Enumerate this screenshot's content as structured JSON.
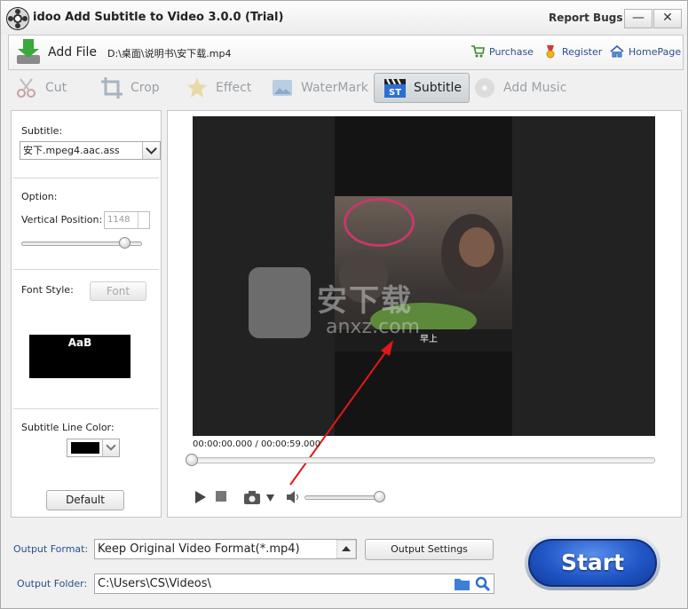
{
  "window": {
    "title": "idoo Add Subtitle to Video 3.0.0 (Trial)",
    "report_bugs": "Report Bugs",
    "minimize": "—",
    "close": "✕"
  },
  "top_bar": {
    "add_file": "Add File",
    "file_path": "D:\\桌面\\说明书\\安下载.mp4",
    "purchase": "Purchase",
    "register": "Register",
    "homepage": "HomePage"
  },
  "tools": {
    "cut": "Cut",
    "crop": "Crop",
    "effect": "Effect",
    "watermark": "WaterMark",
    "subtitle": "Subtitle",
    "add_music": "Add Music"
  },
  "left_panel": {
    "subtitle_label": "Subtitle:",
    "subtitle_value": "安下.mpeg4.aac.ass",
    "option_label": "Option:",
    "vertical_position_label": "Vertical Position:",
    "vertical_position_value": "1148",
    "vertical_position_slider_fraction": 0.85,
    "font_style_label": "Font Style:",
    "font_button": "Font",
    "font_preview": "AaB",
    "subtitle_line_color_label": "Subtitle Line Color:",
    "subtitle_line_color": "#000000",
    "default_button": "Default"
  },
  "player": {
    "current_time": "00:00:00.000",
    "separator": "/",
    "total_time": "00:00:59.000",
    "subtitle_text": "早上",
    "watermark_text": "安下载",
    "watermark_sub": "anxz.com"
  },
  "bottom": {
    "output_format_label": "Output Format:",
    "output_format_value": "Keep Original Video Format(*.mp4)",
    "output_settings_button": "Output Settings",
    "output_folder_label": "Output Folder:",
    "output_folder_value": "C:\\Users\\CS\\Videos\\",
    "start_button": "Start"
  }
}
